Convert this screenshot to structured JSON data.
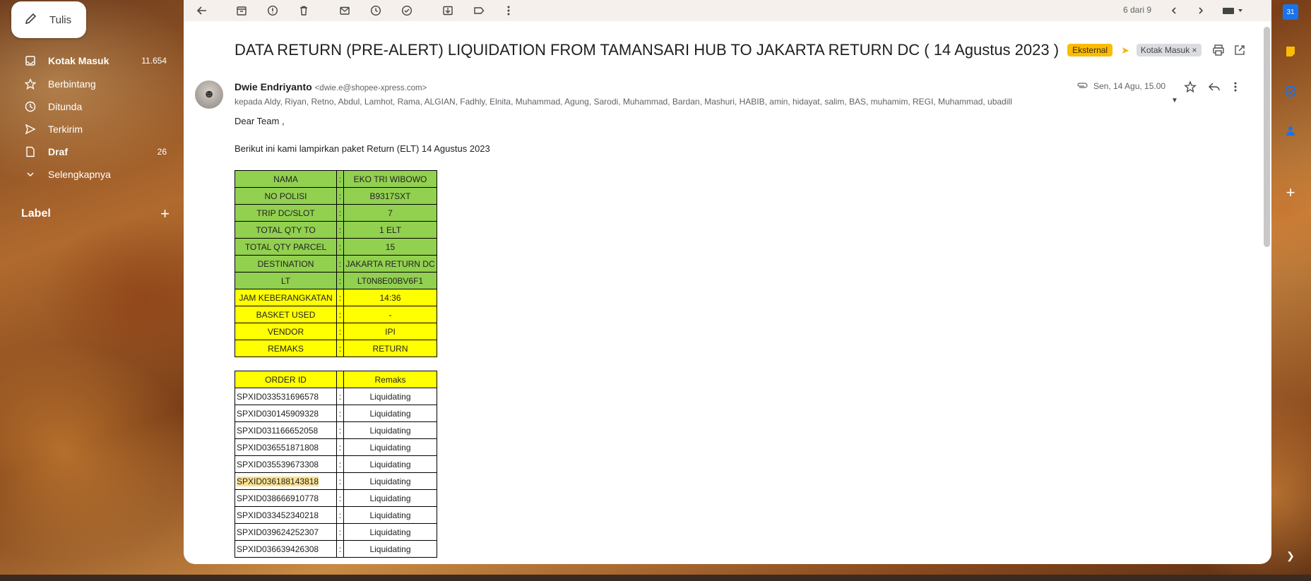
{
  "nav": {
    "compose": "Tulis",
    "items": [
      {
        "label": "Kotak Masuk",
        "count": "11.654",
        "icon": "inbox-icon"
      },
      {
        "label": "Berbintang",
        "count": "",
        "icon": "star-icon"
      },
      {
        "label": "Ditunda",
        "count": "",
        "icon": "clock-icon"
      },
      {
        "label": "Terkirim",
        "count": "",
        "icon": "send-icon"
      },
      {
        "label": "Draf",
        "count": "26",
        "icon": "draft-icon"
      },
      {
        "label": "Selengkapnya",
        "count": "",
        "icon": "chevron-down-icon"
      }
    ],
    "label_header": "Label"
  },
  "toolbar": {
    "pager": "6 dari 9"
  },
  "email": {
    "subject": "DATA RETURN (PRE-ALERT) LIQUIDATION FROM TAMANSARI HUB TO JAKARTA RETURN DC ( 14 Agustus 2023 )",
    "badge_external": "Eksternal",
    "badge_inbox": "Kotak Masuk",
    "sender_name": "Dwie Endriyanto",
    "sender_email": "<dwie.e@shopee-xpress.com>",
    "recipients": "kepada Aldy, Riyan, Retno, Abdul, Lamhot, Rama, ALGIAN, Fadhly, Elnita, Muhammad, Agung, Sarodi, Muhammad, Bardan, Mashuri, HABIB, amin, hidayat, salim, BAS, muhamim, REGI, Muhammad, ubadillah, harvala, alfriza, bas_riski.agus, Ravi, G",
    "date": "Sen, 14 Agu, 15.00",
    "greeting": "Dear Team ,",
    "intro": "Berikut ini kami lampirkan paket Return (ELT) 14 Agustus  2023",
    "info_table": [
      {
        "label": "NAMA",
        "sep": ":",
        "value": "EKO TRI WIBOWO",
        "color": "green"
      },
      {
        "label": "NO POLISI",
        "sep": ":",
        "value": "B9317SXT",
        "color": "green"
      },
      {
        "label": "TRIP DC/SLOT",
        "sep": ":",
        "value": "7",
        "color": "green"
      },
      {
        "label": "TOTAL QTY TO",
        "sep": ":",
        "value": "1 ELT",
        "color": "green"
      },
      {
        "label": "TOTAL QTY PARCEL",
        "sep": ":",
        "value": "15",
        "color": "green"
      },
      {
        "label": "DESTINATION",
        "sep": ":",
        "value": "JAKARTA RETURN DC",
        "color": "green"
      },
      {
        "label": "LT",
        "sep": ":",
        "value": "LT0N8E00BV6F1",
        "color": "green"
      },
      {
        "label": "JAM KEBERANGKATAN",
        "sep": ":",
        "value": "14:36",
        "color": "yellow"
      },
      {
        "label": "BASKET USED",
        "sep": ":",
        "value": "-",
        "color": "yellow"
      },
      {
        "label": "VENDOR",
        "sep": ":",
        "value": "IPI",
        "color": "yellow"
      },
      {
        "label": "REMAKS",
        "sep": ":",
        "value": "RETURN",
        "color": "yellow"
      }
    ],
    "order_header": {
      "id": "ORDER ID",
      "remaks": "Remaks"
    },
    "orders": [
      {
        "id": "SPXID033531696578",
        "sep": ":",
        "status": "Liquidating"
      },
      {
        "id": "SPXID030145909328",
        "sep": ":",
        "status": "Liquidating"
      },
      {
        "id": "SPXID031166652058",
        "sep": ":",
        "status": "Liquidating"
      },
      {
        "id": "SPXID036551871808",
        "sep": ":",
        "status": "Liquidating"
      },
      {
        "id": "SPXID035539673308",
        "sep": ":",
        "status": "Liquidating"
      },
      {
        "id": "SPXID036188143818",
        "sep": ":",
        "status": "Liquidating",
        "highlight": true
      },
      {
        "id": "SPXID038666910778",
        "sep": ":",
        "status": "Liquidating"
      },
      {
        "id": "SPXID033452340218",
        "sep": ":",
        "status": "Liquidating"
      },
      {
        "id": "SPXID039624252307",
        "sep": ":",
        "status": "Liquidating"
      },
      {
        "id": "SPXID036639426308",
        "sep": ":",
        "status": "Liquidating"
      }
    ]
  }
}
